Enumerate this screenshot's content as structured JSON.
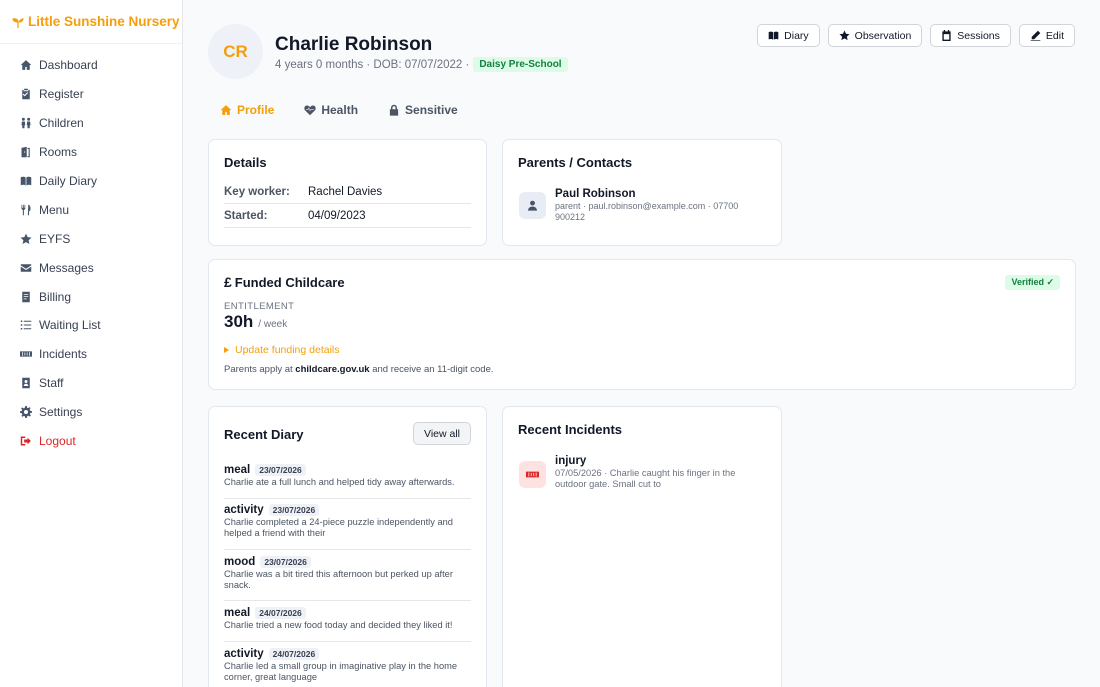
{
  "brand": {
    "name": "Little Sunshine Nursery",
    "icon": "sprout-icon",
    "color": "#f59e0b"
  },
  "sidebar": {
    "items": [
      {
        "label": "Dashboard",
        "icon": "home-icon"
      },
      {
        "label": "Register",
        "icon": "clipboard-icon"
      },
      {
        "label": "Children",
        "icon": "children-icon"
      },
      {
        "label": "Rooms",
        "icon": "door-icon"
      },
      {
        "label": "Daily Diary",
        "icon": "book-icon"
      },
      {
        "label": "Menu",
        "icon": "utensils-icon"
      },
      {
        "label": "EYFS",
        "icon": "star-icon"
      },
      {
        "label": "Messages",
        "icon": "envelope-icon"
      },
      {
        "label": "Billing",
        "icon": "invoice-icon"
      },
      {
        "label": "Waiting List",
        "icon": "list-icon"
      },
      {
        "label": "Incidents",
        "icon": "bandage-icon"
      },
      {
        "label": "Staff",
        "icon": "id-badge-icon"
      },
      {
        "label": "Settings",
        "icon": "gear-icon"
      },
      {
        "label": "Logout",
        "icon": "logout-icon"
      }
    ]
  },
  "child": {
    "initials": "CR",
    "name": "Charlie Robinson",
    "meta": "4 years 0 months · DOB: 07/07/2022 ·",
    "room": "Daisy Pre-School"
  },
  "actions": {
    "diary": "Diary",
    "observation": "Observation",
    "sessions": "Sessions",
    "edit": "Edit"
  },
  "tabs": {
    "profile": "Profile",
    "health": "Health",
    "sensitive": "Sensitive"
  },
  "details": {
    "title": "Details",
    "rows": [
      {
        "key": "Key worker:",
        "value": "Rachel Davies"
      },
      {
        "key": "Started:",
        "value": "04/09/2023"
      }
    ]
  },
  "contacts": {
    "title": "Parents / Contacts",
    "items": [
      {
        "name": "Paul Robinson",
        "detail": "parent · paul.robinson@example.com · 07700 900212"
      }
    ]
  },
  "funded": {
    "title": "Funded Childcare",
    "symbol": "£",
    "status": "Verified ✓",
    "entitlement_label": "ENTITLEMENT",
    "entitlement_value": "30h",
    "entitlement_unit": "/ week",
    "update_link": "Update funding details",
    "note_prefix": "Parents apply at ",
    "note_link": "childcare.gov.uk",
    "note_suffix": " and receive an 11-digit code."
  },
  "diary": {
    "title": "Recent Diary",
    "view_all": "View all",
    "entries": [
      {
        "type": "meal",
        "date": "23/07/2026",
        "text": "Charlie ate a full lunch and helped tidy away afterwards."
      },
      {
        "type": "activity",
        "date": "23/07/2026",
        "text": "Charlie completed a 24-piece puzzle independently and helped a friend with their"
      },
      {
        "type": "mood",
        "date": "23/07/2026",
        "text": "Charlie was a bit tired this afternoon but perked up after snack."
      },
      {
        "type": "meal",
        "date": "24/07/2026",
        "text": "Charlie tried a new food today and decided they liked it!"
      },
      {
        "type": "activity",
        "date": "24/07/2026",
        "text": "Charlie led a small group in imaginative play in the home corner, great language"
      }
    ]
  },
  "incidents": {
    "title": "Recent Incidents",
    "items": [
      {
        "type": "injury",
        "text": "07/05/2026 · Charlie caught his finger in the outdoor gate. Small cut to"
      }
    ]
  }
}
